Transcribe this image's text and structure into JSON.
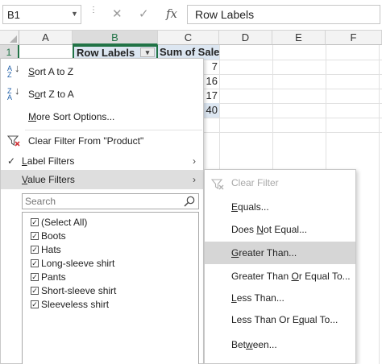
{
  "formula_bar": {
    "namebox": "B1",
    "namebox_arrow": "▼",
    "dots": "⋮",
    "cancel": "✕",
    "enter": "✓",
    "fx": "fx",
    "value": "Row Labels"
  },
  "grid": {
    "columns": [
      "A",
      "B",
      "C",
      "D",
      "E",
      "F"
    ],
    "rows": [
      "1"
    ],
    "cells": {
      "b1": "Row Labels",
      "c1": "Sum of Sales",
      "c2": "7",
      "c3": "16",
      "c4": "17",
      "c5": "40"
    },
    "accent_color": "#217346",
    "selection_fill": "#dce6f1"
  },
  "filter_menu": {
    "sort_az": {
      "pre": "",
      "key": "S",
      "post": "ort A to Z"
    },
    "sort_za": {
      "pre": "S",
      "key": "o",
      "post": "rt Z to A"
    },
    "more_sort": {
      "pre": "",
      "key": "M",
      "post": "ore Sort Options..."
    },
    "clear_filter": "Clear Filter From \"Product\"",
    "label_filters": {
      "pre": "",
      "key": "L",
      "post": "abel Filters"
    },
    "value_filters": {
      "pre": "",
      "key": "V",
      "post": "alue Filters"
    },
    "search_placeholder": "Search",
    "items": [
      "(Select All)",
      "Boots",
      "Hats",
      "Long-sleeve shirt",
      "Pants",
      "Short-sleeve shirt",
      "Sleeveless shirt"
    ],
    "arrow": "›",
    "check": "✓",
    "item_check": "✓"
  },
  "value_submenu": {
    "clear_filter": "Clear Filter",
    "items": [
      {
        "pre": "",
        "key": "E",
        "post": "quals..."
      },
      {
        "pre": "Does ",
        "key": "N",
        "post": "ot Equal..."
      },
      {
        "pre": "",
        "key": "G",
        "post": "reater Than..."
      },
      {
        "pre": "Greater Than ",
        "key": "O",
        "post": "r Equal To..."
      },
      {
        "pre": "",
        "key": "L",
        "post": "ess Than..."
      },
      {
        "pre": "Less Than Or E",
        "key": "q",
        "post": "ual To..."
      },
      {
        "pre": "Bet",
        "key": "w",
        "post": "een..."
      }
    ]
  }
}
